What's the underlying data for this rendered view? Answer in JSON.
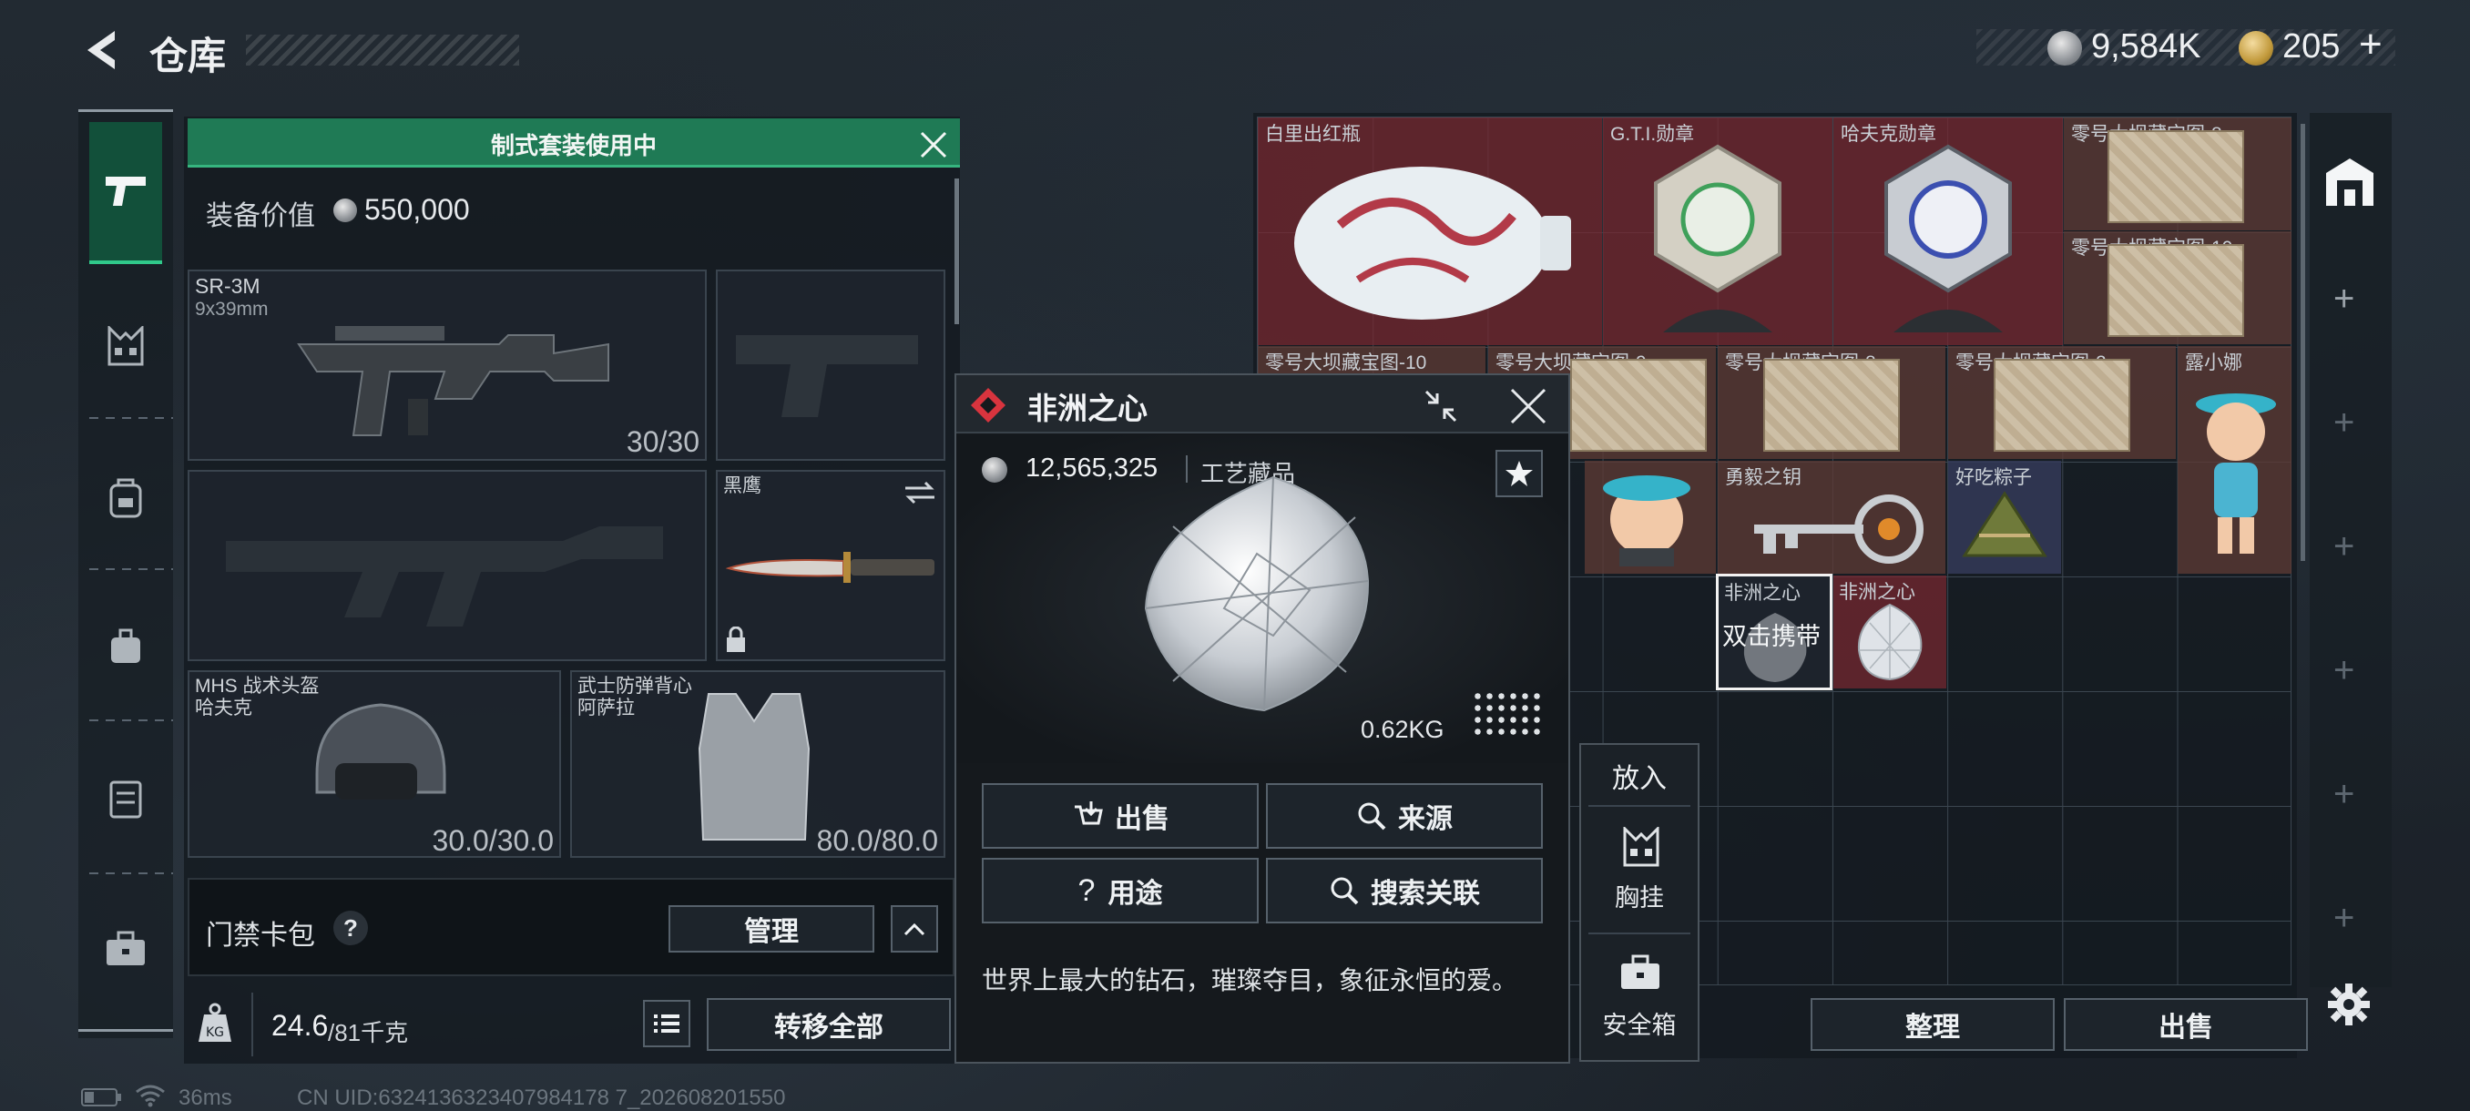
{
  "header": {
    "title": "仓库"
  },
  "currency": [
    {
      "icon": "silver-coin-icon",
      "value": "9,584K"
    },
    {
      "icon": "gold-coin-icon",
      "value": "205"
    }
  ],
  "loadout": {
    "banner": "制式套装使用中",
    "value_label": "装备价值",
    "value": "550,000",
    "primary_weapon": {
      "name": "SR-3M",
      "caliber": "9x39mm",
      "ammo": "30/30"
    },
    "melee": {
      "name": "黑鹰"
    },
    "helmet": {
      "name": "MHS 战术头盔",
      "sub": "哈夫克",
      "durability": "30.0/30.0"
    },
    "armor": {
      "name": "武士防弹背心",
      "sub": "阿萨拉",
      "durability": "80.0/80.0"
    },
    "keycard": {
      "label": "门禁卡包",
      "help": "?",
      "manage": "管理"
    },
    "weight": {
      "current": "24.6",
      "max": "/81千克"
    },
    "transfer_all": "转移全部"
  },
  "stash": {
    "items": [
      {
        "name": "白里出红瓶"
      },
      {
        "name": "G.T.I.勋章"
      },
      {
        "name": "哈夫克勋章"
      },
      {
        "name": "零号大坝藏宝图-8"
      },
      {
        "name": "零号大坝藏宝图-10"
      },
      {
        "name": "零号大坝藏宝图-10"
      },
      {
        "name": "零号大坝藏宝图-9"
      },
      {
        "name": "零号大坝藏宝图-8"
      },
      {
        "name": "零号大坝藏宝图-2"
      },
      {
        "name": "露小娜"
      },
      {
        "name": "勇毅之钥"
      },
      {
        "name": "好吃粽子"
      },
      {
        "name": "非洲之心",
        "hint": "双击携带"
      },
      {
        "name": "非洲之心"
      }
    ],
    "sort": "整理",
    "sell": "出售"
  },
  "container_menu": {
    "title": "放入",
    "chest_rig": "胸挂",
    "safe_box": "安全箱"
  },
  "popup": {
    "title": "非洲之心",
    "price": "12,565,325",
    "category": "工艺藏品",
    "weight": "0.62KG",
    "buttons": {
      "sell": "出售",
      "source": "来源",
      "usage": "用途",
      "search": "搜索关联"
    },
    "description": "世界上最大的钻石，璀璨夺目，象征永恒的爱。"
  },
  "status": {
    "ping": "36ms",
    "uid": "CN UID:6324136323407984178 7_202608201550"
  },
  "colors": {
    "banner": "#1f7a55",
    "popup_accent": "#d8343e",
    "selected": "#f2f2f2"
  }
}
